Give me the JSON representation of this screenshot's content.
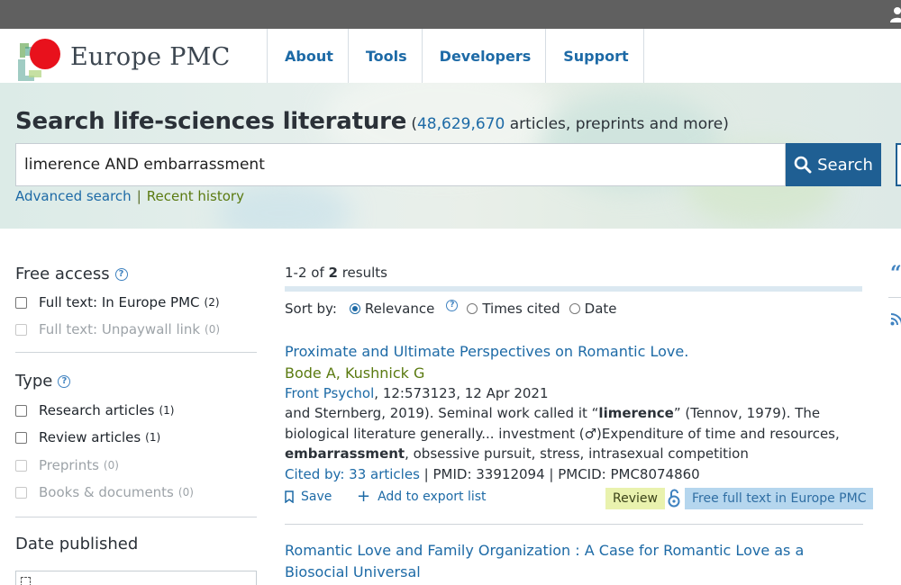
{
  "brand": {
    "name": "Europe PMC",
    "colors": {
      "link": "#1d6aa6",
      "green_link": "#5a7a10",
      "search_button": "#1f5f93"
    }
  },
  "nav": [
    "About",
    "Tools",
    "Developers",
    "Support"
  ],
  "hero": {
    "title": "Search life-sciences literature",
    "paren_open": "(",
    "count": "48,629,670",
    "count_suffix": " articles, preprints and more)",
    "query": "limerence AND embarrassment",
    "search_label": "Search",
    "advanced_search": "Advanced search",
    "separator": "|",
    "recent_history": "Recent history"
  },
  "filters": {
    "free_access": {
      "title": "Free access",
      "options": [
        {
          "label": "Full text: In Europe PMC",
          "count": "(2)",
          "enabled": true
        },
        {
          "label": "Full text: Unpaywall link",
          "count": "(0)",
          "enabled": false
        }
      ]
    },
    "type": {
      "title": "Type",
      "options": [
        {
          "label": "Research articles",
          "count": "(1)",
          "enabled": true
        },
        {
          "label": "Review articles",
          "count": "(1)",
          "enabled": true
        },
        {
          "label": "Preprints",
          "count": "(0)",
          "enabled": false
        },
        {
          "label": "Books & documents",
          "count": "(0)",
          "enabled": false
        }
      ]
    },
    "date_published": {
      "title": "Date published"
    }
  },
  "results_header": {
    "range": "1-2 of ",
    "total": "2",
    "suffix": " results",
    "sort_label": "Sort by:",
    "sort_options": [
      "Relevance",
      "Times cited",
      "Date"
    ],
    "sort_selected": "Relevance"
  },
  "results": [
    {
      "title": "Proximate and Ultimate Perspectives on Romantic Love.",
      "authors": "Bode A, Kushnick G",
      "journal": "Front Psychol",
      "citation": ", 12:573123, 12 Apr 2021",
      "snippet_1": "and Sternberg, 2019). Seminal work called it “",
      "snippet_hl_1": "limerence",
      "snippet_2": "” (Tennov, 1979). The biological literature generally... investment (♂)Expenditure of time and resources, ",
      "snippet_hl_2": "embarrassment",
      "snippet_3": ", obsessive pursuit, stress, intrasexual competition",
      "cited_by": "Cited by: 33 articles",
      "ids": " | PMID: 33912094 | PMCID: PMC8074860",
      "save": "Save",
      "export": "Add to export list",
      "badge_review": "Review",
      "badge_fulltext": "Free full text in Europe PMC"
    },
    {
      "title": "Romantic Love and Family Organization : A Case for Romantic Love as a Biosocial Universal"
    }
  ],
  "rail": {
    "quote_icon": "quote-icon",
    "rss_icon": "rss-icon"
  }
}
